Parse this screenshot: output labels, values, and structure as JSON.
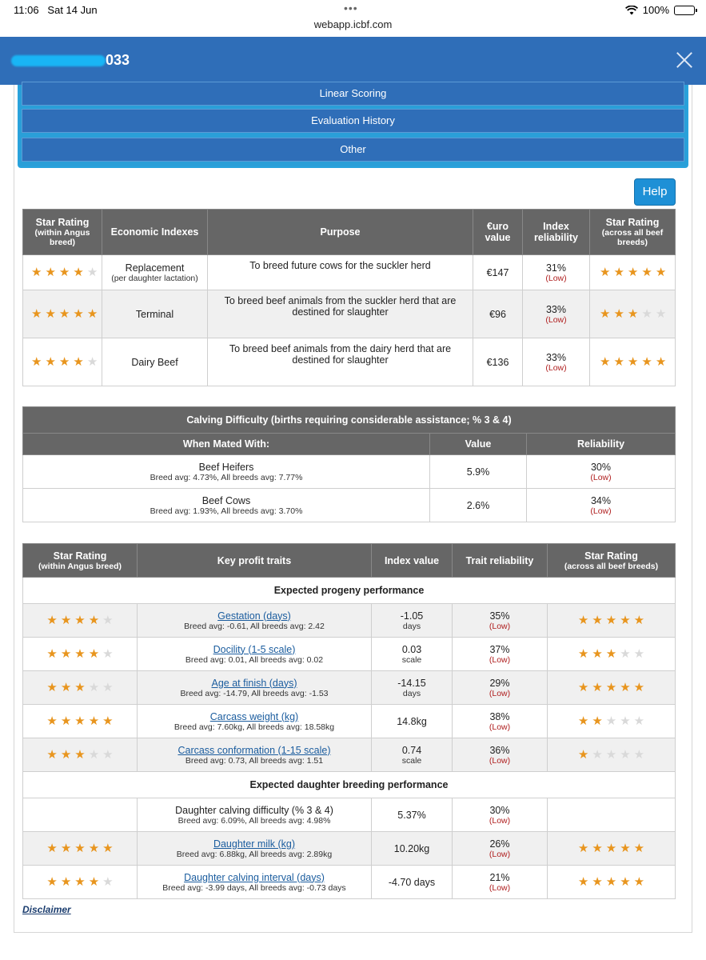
{
  "status": {
    "time": "11:06",
    "date": "Sat 14 Jun",
    "url": "webapp.icbf.com",
    "battery": "100%"
  },
  "header": {
    "title_suffix": "033"
  },
  "nav": [
    "Linear Scoring",
    "Evaluation History",
    "Other"
  ],
  "help_label": "Help",
  "indexes": {
    "headers": {
      "star_rating": "Star Rating",
      "star_rating_sub": "(within Angus breed)",
      "economic": "Economic Indexes",
      "purpose": "Purpose",
      "euro": "€uro value",
      "reliability": "Index reliability",
      "star_all": "Star Rating",
      "star_all_sub": "(across all beef breeds)"
    },
    "rows": [
      {
        "stars": 4,
        "name": "Replacement",
        "name_sub": "(per daughter lactation)",
        "purpose": "To breed future cows for the suckler herd",
        "value": "€147",
        "rel": "31%",
        "rel_sub": "(Low)",
        "stars_all": 5
      },
      {
        "stars": 5,
        "name": "Terminal",
        "name_sub": "",
        "purpose": "To breed beef animals from the suckler herd that are destined for slaughter",
        "value": "€96",
        "rel": "33%",
        "rel_sub": "(Low)",
        "stars_all": 3
      },
      {
        "stars": 4,
        "name": "Dairy Beef",
        "name_sub": "",
        "purpose": "To breed beef animals from the dairy herd that are destined for slaughter",
        "value": "€136",
        "rel": "33%",
        "rel_sub": "(Low)",
        "stars_all": 5
      }
    ]
  },
  "calving": {
    "title": "Calving Difficulty (births requiring considerable assistance; % 3 & 4)",
    "headers": {
      "mated": "When Mated With:",
      "value": "Value",
      "reliability": "Reliability"
    },
    "rows": [
      {
        "name": "Beef Heifers",
        "avg": "Breed avg: 4.73%, All breeds avg: 7.77%",
        "value": "5.9%",
        "rel": "30%",
        "rel_sub": "(Low)"
      },
      {
        "name": "Beef Cows",
        "avg": "Breed avg: 1.93%, All breeds avg: 3.70%",
        "value": "2.6%",
        "rel": "34%",
        "rel_sub": "(Low)"
      }
    ]
  },
  "traits": {
    "headers": {
      "star_rating": "Star Rating",
      "star_rating_sub": "(within Angus breed)",
      "key": "Key profit traits",
      "index": "Index value",
      "rel": "Trait reliability",
      "star_all": "Star Rating",
      "star_all_sub": "(across all beef breeds)"
    },
    "section1": "Expected progeny performance",
    "progeny": [
      {
        "stars": 4,
        "name": "Gestation (days)",
        "avg": "Breed avg: -0.61, All breeds avg: 2.42",
        "value": "-1.05",
        "unit": "days",
        "rel": "35%",
        "rel_sub": "(Low)",
        "stars_all": 5,
        "link": true
      },
      {
        "stars": 4,
        "name": "Docility (1-5 scale)",
        "avg": "Breed avg: 0.01, All breeds avg: 0.02",
        "value": "0.03",
        "unit": "scale",
        "rel": "37%",
        "rel_sub": "(Low)",
        "stars_all": 3,
        "link": true
      },
      {
        "stars": 3,
        "name": "Age at finish (days)",
        "avg": "Breed avg: -14.79, All breeds avg: -1.53",
        "value": "-14.15",
        "unit": "days",
        "rel": "29%",
        "rel_sub": "(Low)",
        "stars_all": 5,
        "link": true
      },
      {
        "stars": 5,
        "name": "Carcass weight (kg)",
        "avg": "Breed avg: 7.60kg, All breeds avg: 18.58kg",
        "value": "14.8kg",
        "unit": "",
        "rel": "38%",
        "rel_sub": "(Low)",
        "stars_all": 2,
        "link": true
      },
      {
        "stars": 3,
        "name": "Carcass conformation (1-15 scale)",
        "avg": "Breed avg: 0.73, All breeds avg: 1.51",
        "value": "0.74",
        "unit": "scale",
        "rel": "36%",
        "rel_sub": "(Low)",
        "stars_all": 1,
        "link": true
      }
    ],
    "section2": "Expected daughter breeding performance",
    "daughter": [
      {
        "stars": 0,
        "name": "Daughter calving difficulty (% 3 & 4)",
        "avg": "Breed avg: 6.09%, All breeds avg: 4.98%",
        "value": "5.37%",
        "unit": "",
        "rel": "30%",
        "rel_sub": "(Low)",
        "stars_all": 0,
        "link": false
      },
      {
        "stars": 5,
        "name": "Daughter milk (kg)",
        "avg": "Breed avg: 6.88kg, All breeds avg: 2.89kg",
        "value": "10.20kg",
        "unit": "",
        "rel": "26%",
        "rel_sub": "(Low)",
        "stars_all": 5,
        "link": true
      },
      {
        "stars": 4,
        "name": "Daughter calving interval (days)",
        "avg": "Breed avg: -3.99 days, All breeds avg: -0.73 days",
        "value": "-4.70 days",
        "unit": "",
        "rel": "21%",
        "rel_sub": "(Low)",
        "stars_all": 5,
        "link": true
      }
    ]
  },
  "disclaimer": "Disclaimer",
  "colors": {
    "header": "#2f6eb8",
    "star": "#e8951e",
    "low": "#b02020",
    "table_head": "#666666"
  }
}
